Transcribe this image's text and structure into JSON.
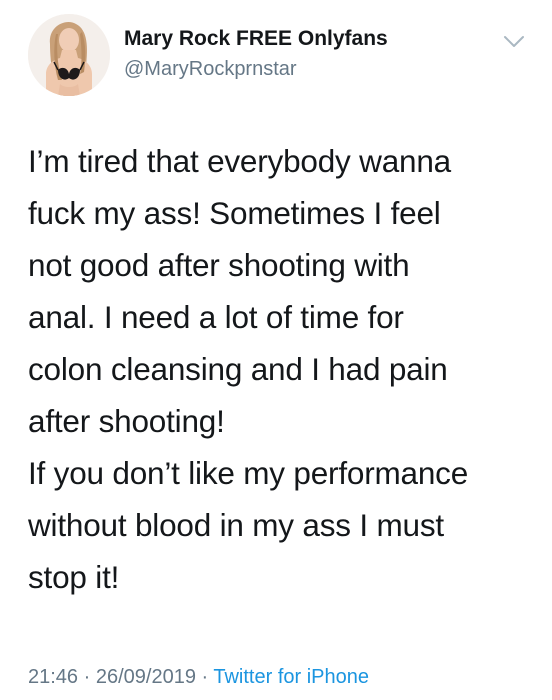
{
  "author": {
    "name": "Mary Rock FREE Onlyfans",
    "handle": "@MaryRockprnstar",
    "avatar_icon": "profile-photo"
  },
  "menu": {
    "icon": "chevron-down-icon"
  },
  "tweet": {
    "lines": [
      "I’m tired that everybody wanna",
      "fuck my ass! Sometimes I feel",
      "not good after shooting with",
      "anal. I need a lot of time for",
      "colon cleansing and I had pain",
      "after shooting!",
      "If you don’t like my performance",
      "without blood in my ass I must",
      "stop it!"
    ]
  },
  "meta": {
    "time": "21:46",
    "separator": " · ",
    "date": "26/09/2019",
    "source": "Twitter for iPhone"
  },
  "colors": {
    "text": "#14171a",
    "secondary": "#657786",
    "link": "#1b95e0",
    "background": "#ffffff"
  }
}
